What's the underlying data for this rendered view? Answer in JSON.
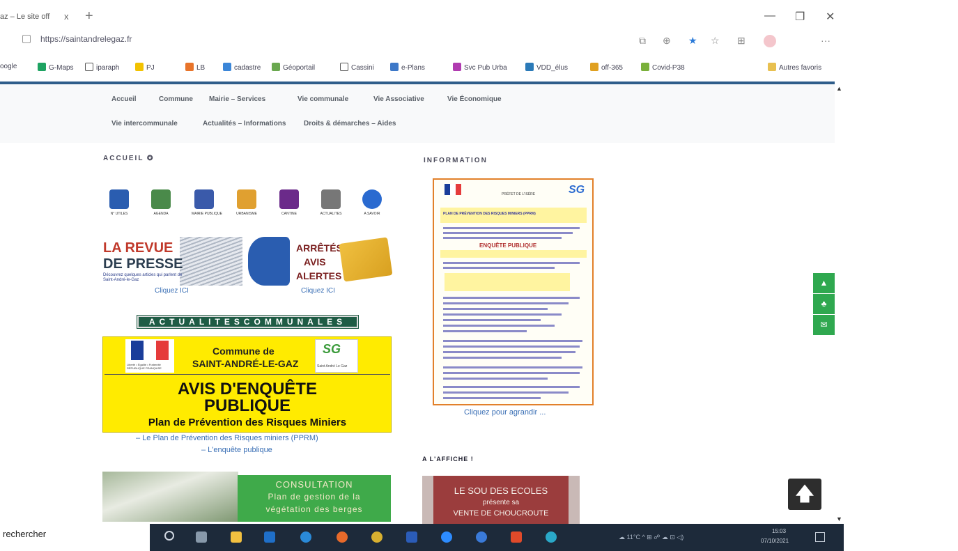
{
  "browser": {
    "tab_title": "az – Le site off",
    "tab_close": "x",
    "new_tab": "+",
    "url": "https://saintandrelegaz.fr",
    "window_buttons": {
      "minimize": "—",
      "restore": "❐",
      "close": "✕"
    },
    "toolbar_more": "···",
    "bookmarks": [
      {
        "label": "oogle",
        "icon": "google-icon",
        "color": "#4285f4"
      },
      {
        "label": "G-Maps",
        "icon": "maps-icon",
        "color": "#1ea362"
      },
      {
        "label": "iparaph",
        "icon": "page-icon",
        "color": "#ffffff"
      },
      {
        "label": "PJ",
        "icon": "pj-icon",
        "color": "#f2c200"
      },
      {
        "label": "LB",
        "icon": "lb-icon",
        "color": "#e8742a"
      },
      {
        "label": "cadastre",
        "icon": "cadastre-icon",
        "color": "#3b86d8"
      },
      {
        "label": "Géoportail",
        "icon": "geoportail-icon",
        "color": "#6aa84f"
      },
      {
        "label": "Cassini",
        "icon": "page-icon",
        "color": "#ffffff"
      },
      {
        "label": "e-Plans",
        "icon": "eplans-icon",
        "color": "#3d78c8"
      },
      {
        "label": "Svc Pub Urba",
        "icon": "urba-icon",
        "color": "#b03bb0"
      },
      {
        "label": "VDD_élus",
        "icon": "vdd-icon",
        "color": "#2b7ab8"
      },
      {
        "label": "off-365",
        "icon": "office-icon",
        "color": "#e0a020"
      },
      {
        "label": "Covid-P38",
        "icon": "covid-icon",
        "color": "#7ab03b"
      }
    ],
    "other_favorites": "Autres favoris"
  },
  "nav": {
    "row1": [
      "Accueil",
      "Commune",
      "Mairie – Services",
      "Vie communale",
      "Vie Associative",
      "Vie Économique"
    ],
    "row2": [
      "Vie intercommunale",
      "Actualités – Informations",
      "Droits & démarches – Aides"
    ]
  },
  "left": {
    "section_title": "ACCUEIL ✪",
    "tiles": [
      {
        "icon": "phone-icon",
        "label": "N° UTILES",
        "color": "#2a5db0"
      },
      {
        "icon": "calendar-icon",
        "label": "AGENDA",
        "color": "#4a8a4a"
      },
      {
        "icon": "republic-icon",
        "label": "MAIRIE PUBLIQUE",
        "color": "#3a5aaa"
      },
      {
        "icon": "plu-icon",
        "label": "URBANISME",
        "color": "#e0a030"
      },
      {
        "icon": "restaurant-icon",
        "label": "CANTINE",
        "color": "#6b2a8a"
      },
      {
        "icon": "people-icon",
        "label": "ACTUALITES",
        "color": "#777777"
      },
      {
        "icon": "info-icon",
        "label": "A SAVOIR",
        "color": "#2a6ad0"
      }
    ],
    "revue": {
      "title1": "LA REVUE",
      "title2": "DE PRESSE",
      "subtitle": "Découvrez quelques articles qui parlent de Saint-André-le-Gaz",
      "click": "Cliquez ICI"
    },
    "arretes": {
      "line1": "ARRÊTÉS",
      "line2": "AVIS",
      "line3": "ALERTES",
      "click": "Cliquez ICI"
    },
    "actu_bar": "ACTUALITESCOMMUNALES",
    "avis": {
      "flag_caption": "Liberté • Égalité • Fraternité RÉPUBLIQUE FRANÇAISE",
      "commune_line1": "Commune de",
      "commune_line2": "SAINT-ANDRÉ-LE-GAZ",
      "logo_mark": "SG",
      "logo_name": "Saint André Le Gaz",
      "heading1": "AVIS D'ENQUÊTE",
      "heading2": "PUBLIQUE",
      "heading3": "Plan de Prévention des Risques Miniers"
    },
    "pprm_link": "– Le Plan de Prévention des Risques miniers (PPRM)",
    "enquete_link": "– L'enquête publique",
    "consultation": {
      "line1": "CONSULTATION",
      "line2": "Plan de gestion de la",
      "line3": "végétation des berges"
    }
  },
  "right": {
    "section_title": "INFORMATION",
    "poster": {
      "prefecture": "PRÉFET DE L'ISÈRE",
      "title": "PLAN DE PRÉVENTION DES RISQUES MINIERS (PPRM)",
      "enquete": "ENQUÊTE PUBLIQUE"
    },
    "click": "Cliquez pour agrandir ...",
    "affiche_title": "A L'AFFICHE !",
    "affiche": {
      "line1": "LE SOU DES ECOLES",
      "line2": "présente sa",
      "line3": "VENTE DE CHOUCROUTE"
    }
  },
  "side_buttons": [
    "▲",
    "♣",
    "✉"
  ],
  "back_to_top": "🡅",
  "taskbar": {
    "search": "rechercher",
    "apps": [
      {
        "icon": "task-view-icon",
        "color": "#8899aa"
      },
      {
        "icon": "explorer-icon",
        "color": "#f2c040"
      },
      {
        "icon": "outlook-icon",
        "color": "#1f6fc8"
      },
      {
        "icon": "edge-icon",
        "color": "#2a8ad8"
      },
      {
        "icon": "firefox-icon",
        "color": "#e86a2a"
      },
      {
        "icon": "chrome-icon",
        "color": "#d8b030"
      },
      {
        "icon": "word-icon",
        "color": "#2b5cb8"
      },
      {
        "icon": "zoom-icon",
        "color": "#2d8cff"
      },
      {
        "icon": "maps-app-icon",
        "color": "#3a7ad8"
      },
      {
        "icon": "office-app-icon",
        "color": "#e04a2a"
      },
      {
        "icon": "edge-beta-icon",
        "color": "#2aa8c8"
      }
    ],
    "tray": "☁ 11°C  ^  ⊞ ☍ ☁ ⊡ ◁)",
    "time": "15:03",
    "date": "07/10/2021"
  }
}
